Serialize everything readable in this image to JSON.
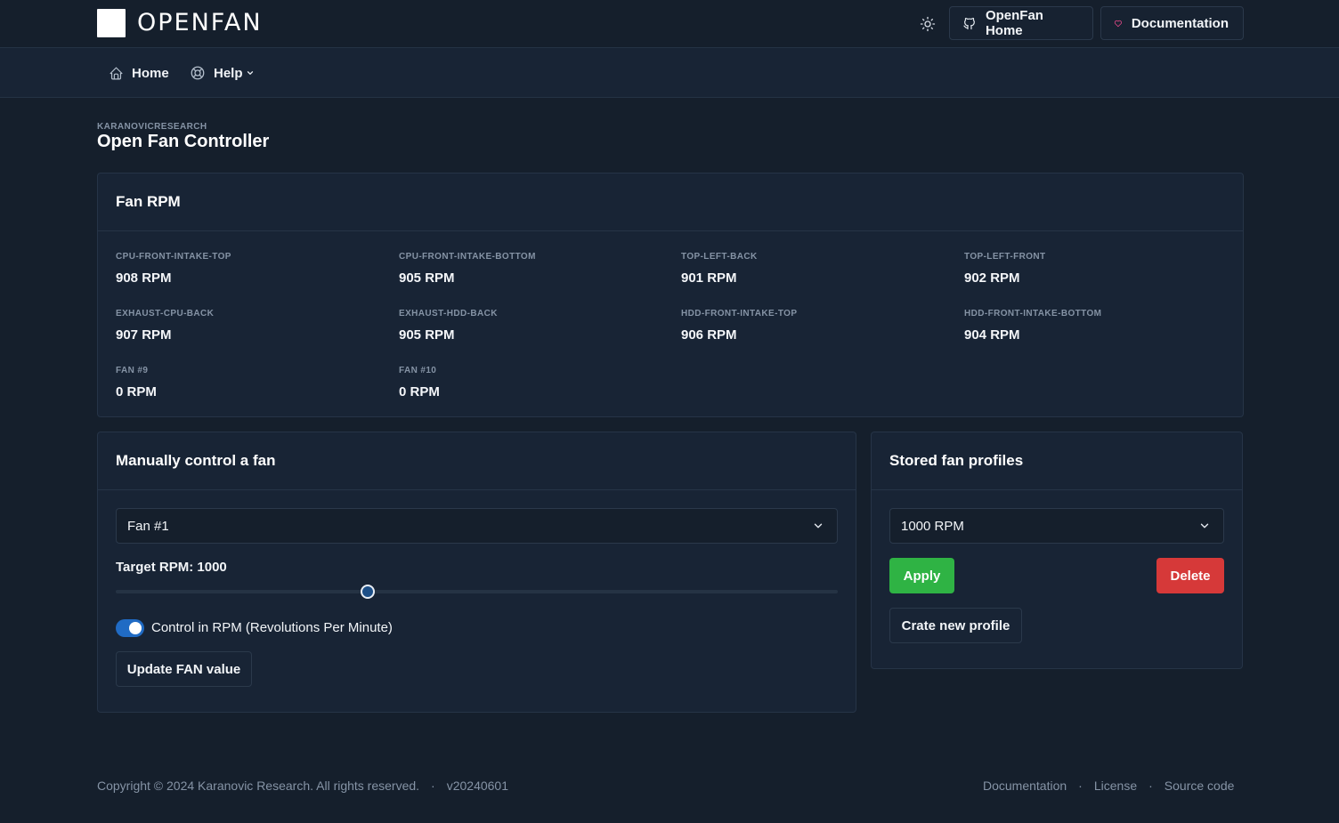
{
  "header": {
    "logo_text": "OPENFAN",
    "github_label": "OpenFan Home",
    "docs_label": "Documentation",
    "icons": {
      "theme": "sun-icon",
      "github": "github-icon",
      "docs": "heart-icon"
    }
  },
  "nav": {
    "home_label": "Home",
    "help_label": "Help"
  },
  "page": {
    "pretitle": "KARANOVICRESEARCH",
    "title": "Open Fan Controller"
  },
  "fan_rpm": {
    "title": "Fan RPM",
    "fans": [
      {
        "label": "CPU-FRONT-INTAKE-TOP",
        "value": "908 RPM"
      },
      {
        "label": "CPU-FRONT-INTAKE-BOTTOM",
        "value": "905 RPM"
      },
      {
        "label": "TOP-LEFT-BACK",
        "value": "901 RPM"
      },
      {
        "label": "TOP-LEFT-FRONT",
        "value": "902 RPM"
      },
      {
        "label": "EXHAUST-CPU-BACK",
        "value": "907 RPM"
      },
      {
        "label": "EXHAUST-HDD-BACK",
        "value": "905 RPM"
      },
      {
        "label": "HDD-FRONT-INTAKE-TOP",
        "value": "906 RPM"
      },
      {
        "label": "HDD-FRONT-INTAKE-BOTTOM",
        "value": "904 RPM"
      },
      {
        "label": "FAN #9",
        "value": "0 RPM"
      },
      {
        "label": "FAN #10",
        "value": "0 RPM"
      }
    ]
  },
  "manual": {
    "title": "Manually control a fan",
    "selected_fan": "Fan #1",
    "target_label": "Target RPM: 1000",
    "slider_fraction": 0.349,
    "toggle_label": "Control in RPM (Revolutions Per Minute)",
    "toggle_on": true,
    "update_label": "Update FAN value"
  },
  "profiles": {
    "title": "Stored fan profiles",
    "selected_profile": "1000 RPM",
    "apply_label": "Apply",
    "delete_label": "Delete",
    "create_label": "Crate new profile"
  },
  "footer": {
    "copyright": "Copyright © 2024 Karanovic Research. All rights reserved.",
    "version": "v20240601",
    "links": [
      "Documentation",
      "License",
      "Source code"
    ]
  },
  "colors": {
    "background": "#151f2c",
    "card": "#182435",
    "apply": "#2fb344",
    "delete": "#d63939",
    "toggle": "#206bc4"
  }
}
